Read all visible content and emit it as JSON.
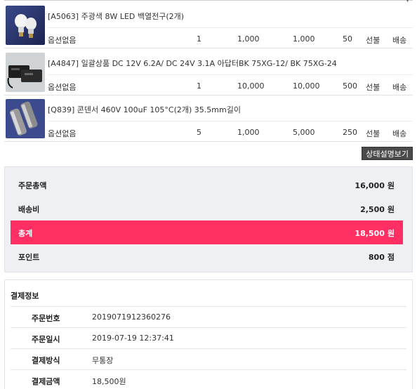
{
  "header": {
    "sort_arrow": "▼"
  },
  "items": [
    {
      "name": "[A5063] 주광색 8W LED 백열전구(2개)",
      "option": "옵션없음",
      "quantity": "1",
      "unit_price": "1,000",
      "amount": "1,000",
      "points": "50",
      "payment": "선불",
      "shipping": "배송",
      "thumb": "led-bulbs"
    },
    {
      "name": "[A4847] 일괄상품 DC 12V 6.2A/ DC 24V 3.1A 아답터BK 75XG-12/ BK 75XG-24",
      "option": "옵션없음",
      "quantity": "1",
      "unit_price": "10,000",
      "amount": "10,000",
      "points": "500",
      "payment": "선불",
      "shipping": "배송",
      "thumb": "power-adapter"
    },
    {
      "name": "[Q839] 콘덴서 460V 100uF 105°C(2개) 35.5mm길이",
      "option": "옵션없음",
      "quantity": "5",
      "unit_price": "1,000",
      "amount": "5,000",
      "points": "250",
      "payment": "선불",
      "shipping": "배송",
      "thumb": "capacitors"
    }
  ],
  "status_button": "상태설명보기",
  "summary": {
    "order_total_label": "주문총액",
    "order_total_value": "16,000",
    "order_total_unit": "원",
    "shipping_label": "배송비",
    "shipping_value": "2,500",
    "shipping_unit": "원",
    "grand_total_label": "총계",
    "grand_total_value": "18,500",
    "grand_total_unit": "원",
    "points_label": "포인트",
    "points_value": "800",
    "points_unit": "점"
  },
  "payment_info": {
    "title": "결제정보",
    "rows": [
      {
        "label": "주문번호",
        "value": "2019071912360276"
      },
      {
        "label": "주문일시",
        "value": "2019-07-19 12:37:41"
      },
      {
        "label": "결제방식",
        "value": "무통장"
      },
      {
        "label": "결제금액",
        "value": "18,500원"
      }
    ]
  },
  "colors": {
    "accent": "#ff2f64",
    "summary_bg": "#eef0f4",
    "button_bg": "#4a4a4a"
  }
}
